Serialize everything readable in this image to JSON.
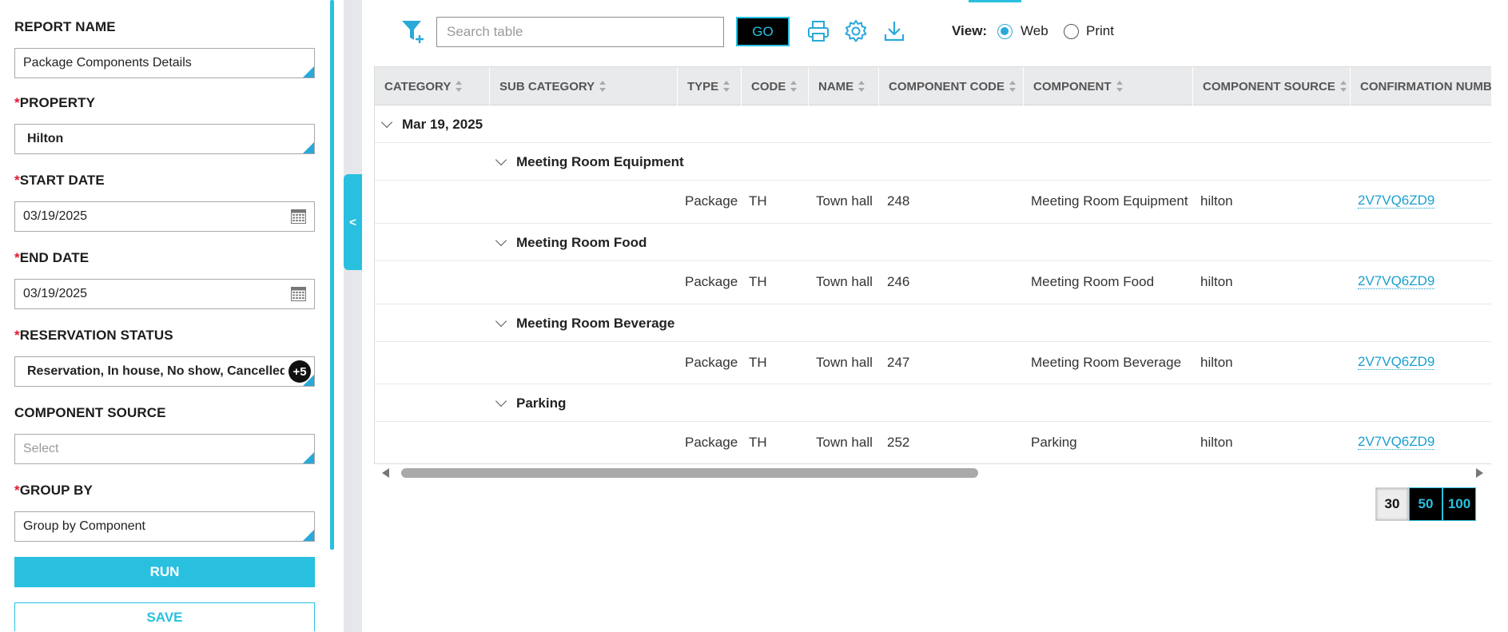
{
  "left_panel": {
    "report_name_label": "REPORT NAME",
    "report_name_value": "Package Components Details",
    "property_label": "PROPERTY",
    "property_value": "Hilton",
    "start_date_label": "START DATE",
    "start_date_value": "03/19/2025",
    "end_date_label": "END DATE",
    "end_date_value": "03/19/2025",
    "reservation_status_label": "RESERVATION STATUS",
    "reservation_status_value": "Reservation, In house, No show, Cancelled,...",
    "reservation_status_more": "+5",
    "component_source_label": "COMPONENT SOURCE",
    "component_source_placeholder": "Select",
    "group_by_label": "GROUP BY",
    "group_by_value": "Group by Component",
    "required_mark": "*",
    "run_label": "RUN",
    "save_label": "SAVE"
  },
  "collapse_toggle": "<",
  "toolbar": {
    "search_placeholder": "Search table",
    "go_label": "GO",
    "icons": [
      "filter-add-icon",
      "print-icon",
      "settings-gear-icon",
      "download-icon"
    ],
    "view_label": "View:",
    "view_options": [
      "Web",
      "Print"
    ],
    "view_selected": "Web"
  },
  "table": {
    "columns": [
      "CATEGORY",
      "SUB CATEGORY",
      "TYPE",
      "CODE",
      "NAME",
      "COMPONENT CODE",
      "COMPONENT",
      "COMPONENT SOURCE",
      "CONFIRMATION NUMBE"
    ],
    "group_date": "Mar 19, 2025",
    "groups": [
      {
        "title": "Meeting Room Equipment",
        "row": {
          "type": "Package",
          "code": "TH",
          "name": "Town hall",
          "component_code": "248",
          "component": "Meeting Room Equipment",
          "source": "hilton",
          "confirmation": "2V7VQ6ZD9"
        }
      },
      {
        "title": "Meeting Room Food",
        "row": {
          "type": "Package",
          "code": "TH",
          "name": "Town hall",
          "component_code": "246",
          "component": "Meeting Room Food",
          "source": "hilton",
          "confirmation": "2V7VQ6ZD9"
        }
      },
      {
        "title": "Meeting Room Beverage",
        "row": {
          "type": "Package",
          "code": "TH",
          "name": "Town hall",
          "component_code": "247",
          "component": "Meeting Room Beverage",
          "source": "hilton",
          "confirmation": "2V7VQ6ZD9"
        }
      },
      {
        "title": "Parking",
        "row": {
          "type": "Package",
          "code": "TH",
          "name": "Town hall",
          "component_code": "252",
          "component": "Parking",
          "source": "hilton",
          "confirmation": "2V7VQ6ZD9"
        }
      }
    ]
  },
  "pagination": {
    "options": [
      "30",
      "50",
      "100"
    ],
    "selected": "30"
  },
  "colors": {
    "accent": "#29c0e0",
    "link": "#1a9fd0",
    "required": "#e0182d"
  }
}
